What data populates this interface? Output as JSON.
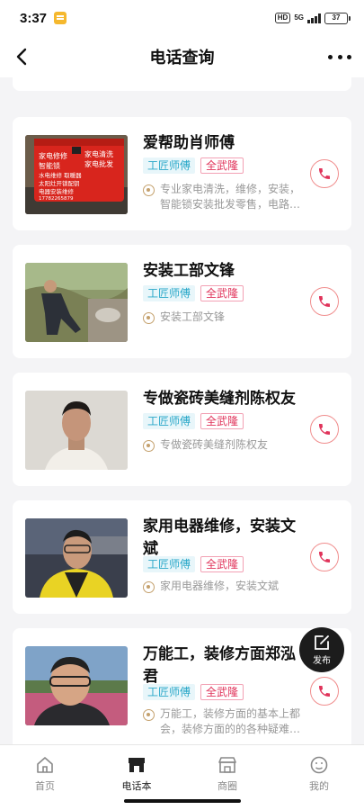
{
  "status_bar": {
    "time": "3:37",
    "hd": "HD",
    "network": "5G",
    "battery": "37"
  },
  "header": {
    "title": "电话查询"
  },
  "listings": [
    {
      "name": "爱帮助肖师傅",
      "category": "工匠师傅",
      "area": "全武隆",
      "description": "专业家电清洗，维修，安装，智能锁安装批发零售，电路…",
      "photo_text": {
        "left": "家电修修",
        "right": "家电清洗",
        "line2l": "智能锁",
        "line2r": "家电批发",
        "line3": "水电维修  取暖器",
        "line4": "太阳灶开锁配钥",
        "line5": "电器安装维修",
        "phone": "17782265879"
      }
    },
    {
      "name": "安装工部文锋",
      "category": "工匠师傅",
      "area": "全武隆",
      "description": "安装工部文锋"
    },
    {
      "name": "专做瓷砖美缝剂陈权友",
      "category": "工匠师傅",
      "area": "全武隆",
      "description": "专做瓷砖美缝剂陈权友"
    },
    {
      "name": "家用电器维修，安装文斌",
      "category": "工匠师傅",
      "area": "全武隆",
      "description": "家用电器维修，安装文斌"
    },
    {
      "name": "万能工，装修方面郑泓君",
      "category": "工匠师傅",
      "area": "全武隆",
      "description": "万能工，装修方面的基本上都会，装修方面的的各种疑难…"
    }
  ],
  "fab": {
    "label": "发布"
  },
  "tabs": [
    {
      "label": "首页",
      "icon": "home-icon"
    },
    {
      "label": "电话本",
      "icon": "phonebook-shop-icon"
    },
    {
      "label": "商圈",
      "icon": "store-icon"
    },
    {
      "label": "我的",
      "icon": "smiley-icon"
    }
  ],
  "colors": {
    "accent_red": "#e0335a",
    "category_blue": "#2aa8c9",
    "location_gold": "#c4a06c"
  }
}
